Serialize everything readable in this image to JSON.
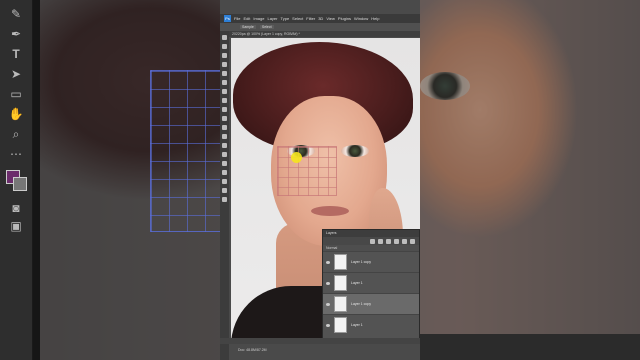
{
  "app": {
    "logo": "Ps"
  },
  "menu": [
    "File",
    "Edit",
    "Image",
    "Layer",
    "Type",
    "Select",
    "Filter",
    "3D",
    "View",
    "Plugins",
    "Window",
    "Help"
  ],
  "options_bar": [
    "Sample",
    "Select"
  ],
  "document": {
    "tab_title": "20220pa @ 100% (Layer 1 copy, RGB/8#) *",
    "status": "Doc: 48.8M/87.2M"
  },
  "layers_panel": {
    "title": "Layers",
    "blend_mode": "Normal",
    "rows": [
      {
        "name": "Layer 1 copy"
      },
      {
        "name": "Layer 1"
      },
      {
        "name": "Layer 1 copy",
        "selected": true
      },
      {
        "name": "Layer 1"
      }
    ]
  },
  "colors": {
    "foreground": "#6b2c6b",
    "background": "#777777",
    "accent": "#2d7fd6"
  },
  "left_toolbar_icons": [
    "brush-icon",
    "pen-icon",
    "type-icon",
    "path-select-icon",
    "rectangle-icon",
    "hand-icon",
    "zoom-icon",
    "more-icon"
  ]
}
